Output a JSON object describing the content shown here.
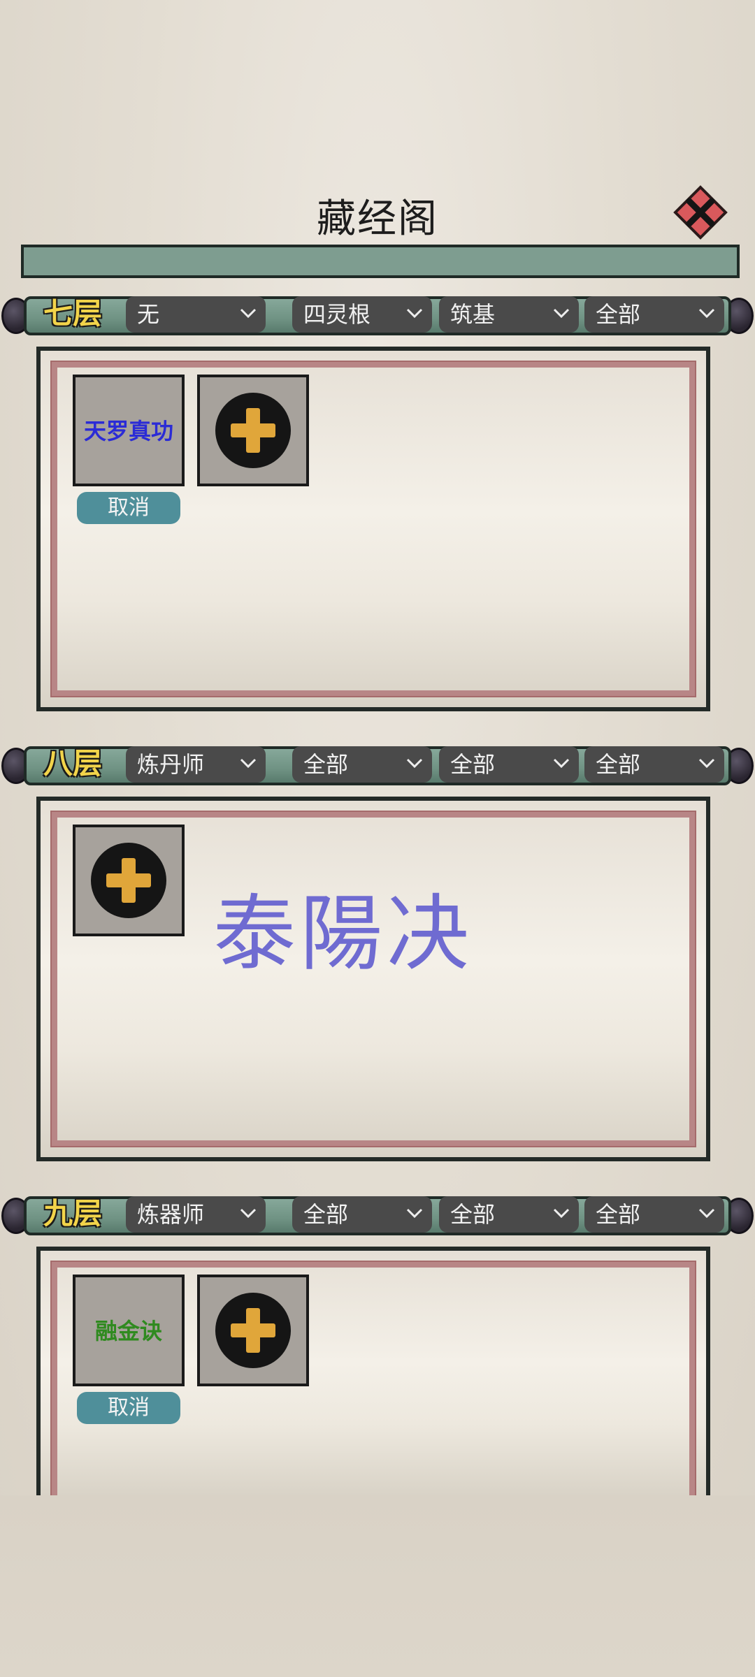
{
  "title": "藏经阁",
  "floors": [
    {
      "label": "七层",
      "filters": [
        "无",
        "四灵根",
        "筑基",
        "全部"
      ],
      "slots": [
        {
          "name": "天罗真功",
          "color": "#2b2bd6",
          "cancel": "取消"
        }
      ],
      "add_slot": true
    },
    {
      "label": "八层",
      "filters": [
        "炼丹师",
        "全部",
        "全部",
        "全部"
      ],
      "slots": [],
      "add_slot": true,
      "overlay_text": "泰陽决"
    },
    {
      "label": "九层",
      "filters": [
        "炼器师",
        "全部",
        "全部",
        "全部"
      ],
      "slots": [
        {
          "name": "融金诀",
          "color": "#2f8a1f",
          "cancel": "取消"
        }
      ],
      "add_slot": true
    }
  ],
  "icons": {
    "close": "close-icon",
    "add": "plus-icon",
    "dropdown": "chevron-down-icon"
  },
  "colors": {
    "floor_label": "#f2d44a",
    "scroll_rod": "#6f9283",
    "dropdown_bg": "#4a4a4a",
    "cancel_bg": "#4f8f9a",
    "overlay_text": "#6f6bd1"
  }
}
